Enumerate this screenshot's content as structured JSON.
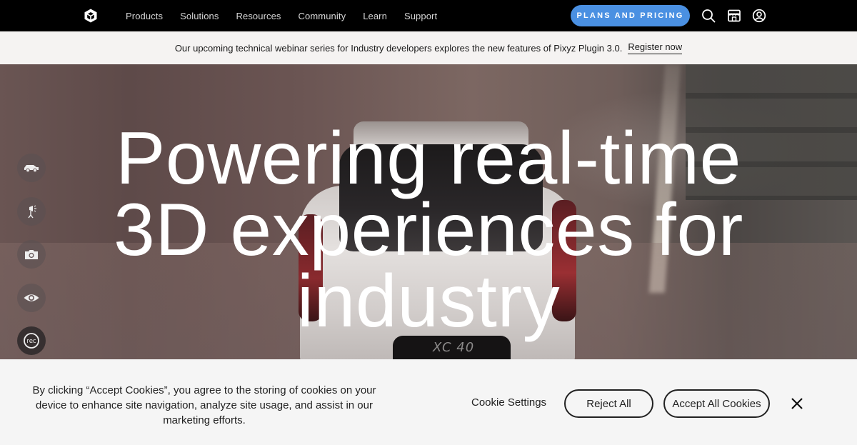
{
  "nav": {
    "logo_icon": "unity-cube-logo",
    "links": [
      "Products",
      "Solutions",
      "Resources",
      "Community",
      "Learn",
      "Support"
    ],
    "pricing_button": "PLANS AND PRICING",
    "icons": [
      "search-icon",
      "store-icon",
      "account-icon"
    ],
    "accent_color": "#4a90e2"
  },
  "announcement": {
    "text": "Our upcoming technical webinar series for Industry developers explores the new features of Pixyz Plugin 3.0.",
    "link": "Register now"
  },
  "hero": {
    "title_lines": [
      "Powering real-time",
      "3D experiences for",
      "industry"
    ],
    "car_badge": "XC 40",
    "tools": [
      {
        "icon": "car-icon"
      },
      {
        "icon": "studio-light-icon"
      },
      {
        "icon": "camera-icon"
      },
      {
        "icon": "eye-icon"
      },
      {
        "icon": "record-icon",
        "label": "rec"
      }
    ]
  },
  "cookie_banner": {
    "text": "By clicking “Accept Cookies”, you agree to the storing of cookies on your device to enhance site navigation, analyze site usage, and assist in our marketing efforts.",
    "settings_label": "Cookie Settings",
    "reject_label": "Reject All",
    "accept_label": "Accept All Cookies",
    "close_icon": "close-icon"
  }
}
